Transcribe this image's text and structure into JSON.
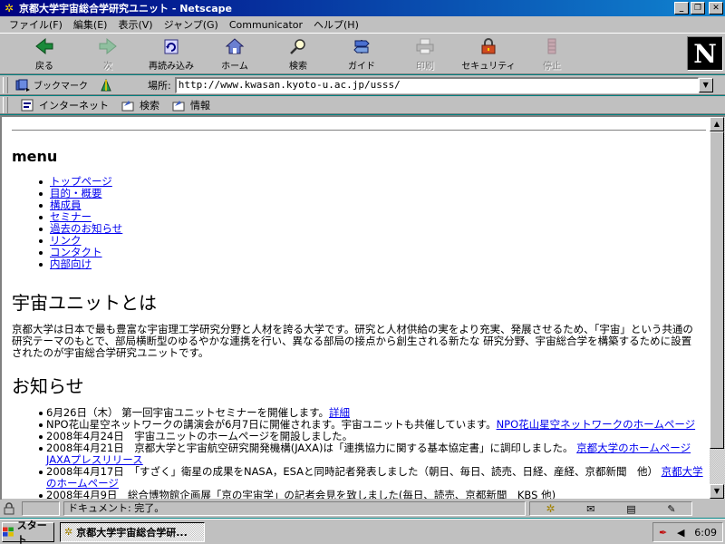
{
  "window": {
    "title": "京都大学宇宙総合学研究ユニット - Netscape",
    "min": "_",
    "max": "❐",
    "close": "✕"
  },
  "menubar": [
    "ファイル(F)",
    "編集(E)",
    "表示(V)",
    "ジャンプ(G)",
    "Communicator",
    "ヘルプ(H)"
  ],
  "toolbar": {
    "buttons": [
      {
        "label": "戻る",
        "icon": "back-arrow-icon",
        "enabled": true
      },
      {
        "label": "次",
        "icon": "forward-arrow-icon",
        "enabled": false
      },
      {
        "label": "再読み込み",
        "icon": "reload-icon",
        "enabled": true
      },
      {
        "label": "ホーム",
        "icon": "home-icon",
        "enabled": true
      },
      {
        "label": "検索",
        "icon": "search-icon",
        "enabled": true
      },
      {
        "label": "ガイド",
        "icon": "guide-icon",
        "enabled": true
      },
      {
        "label": "印刷",
        "icon": "print-icon",
        "enabled": false
      },
      {
        "label": "セキュリティ",
        "icon": "lock-icon",
        "enabled": true
      },
      {
        "label": "停止",
        "icon": "stop-icon",
        "enabled": false
      }
    ],
    "logo": "N"
  },
  "location": {
    "bookmarks_label": "ブックマーク",
    "label": "場所:",
    "url": "http://www.kwasan.kyoto-u.ac.jp/usss/"
  },
  "personal_toolbar": [
    {
      "label": "インターネット",
      "icon": "internet-icon"
    },
    {
      "label": "検索",
      "icon": "search-bookmark-icon"
    },
    {
      "label": "情報",
      "icon": "info-bookmark-icon"
    }
  ],
  "page": {
    "menu_heading": "menu",
    "nav": [
      "トップページ",
      "目的・概要",
      "構成員",
      "セミナー",
      "過去のお知らせ",
      "リンク",
      "コンタクト",
      "内部向け"
    ],
    "section1_title": "宇宙ユニットとは",
    "section1_text": "京都大学は日本で最も豊富な宇宙理工学研究分野と人材を誇る大学です。研究と人材供給の実をより充実、発展させるため、「宇宙」という共通の研究テーマのもとで、部局横断型のゆるやかな連携を行い、異なる部局の接点から創生される新たな 研究分野、宇宙総合学を構築するために設置されたのが宇宙総合学研究ユニットです。",
    "section2_title": "お知らせ",
    "news": [
      {
        "text": "6月26日（木） 第一回宇宙ユニットセミナーを開催します。",
        "link": "詳細"
      },
      {
        "text": "NPO花山星空ネットワークの講演会が6月7日に開催されます。宇宙ユニットも共催しています。",
        "link": "NPO花山星空ネットワークのホームページ"
      },
      {
        "text": "2008年4月24日　宇宙ユニットのホームページを開設しました。",
        "link": ""
      },
      {
        "text": "2008年4月21日　京都大学と宇宙航空研究開発機構(JAXA)は「連携協力に関する基本協定書」に調印しました。",
        "link": "京都大学のホームページ",
        "link2": "JAXAプレスリリース"
      },
      {
        "text": "2008年4月17日　「すざく」衛星の成果をNASA，ESAと同時記者発表しました（朝日、毎日、読売、日経、産経、京都新聞　他）",
        "link": "京都大学のホームページ"
      },
      {
        "text": "2008年4月9日　総合博物館企画展「京の宇宙学」の記者会見を致しました(毎日、読売、京都新聞　KBS 他)",
        "link": ""
      }
    ]
  },
  "status": {
    "text": "ドキュメント: 完了。"
  },
  "taskbar": {
    "start": "スタート",
    "task": "京都大学宇宙総合学研...",
    "clock": "6:09"
  }
}
